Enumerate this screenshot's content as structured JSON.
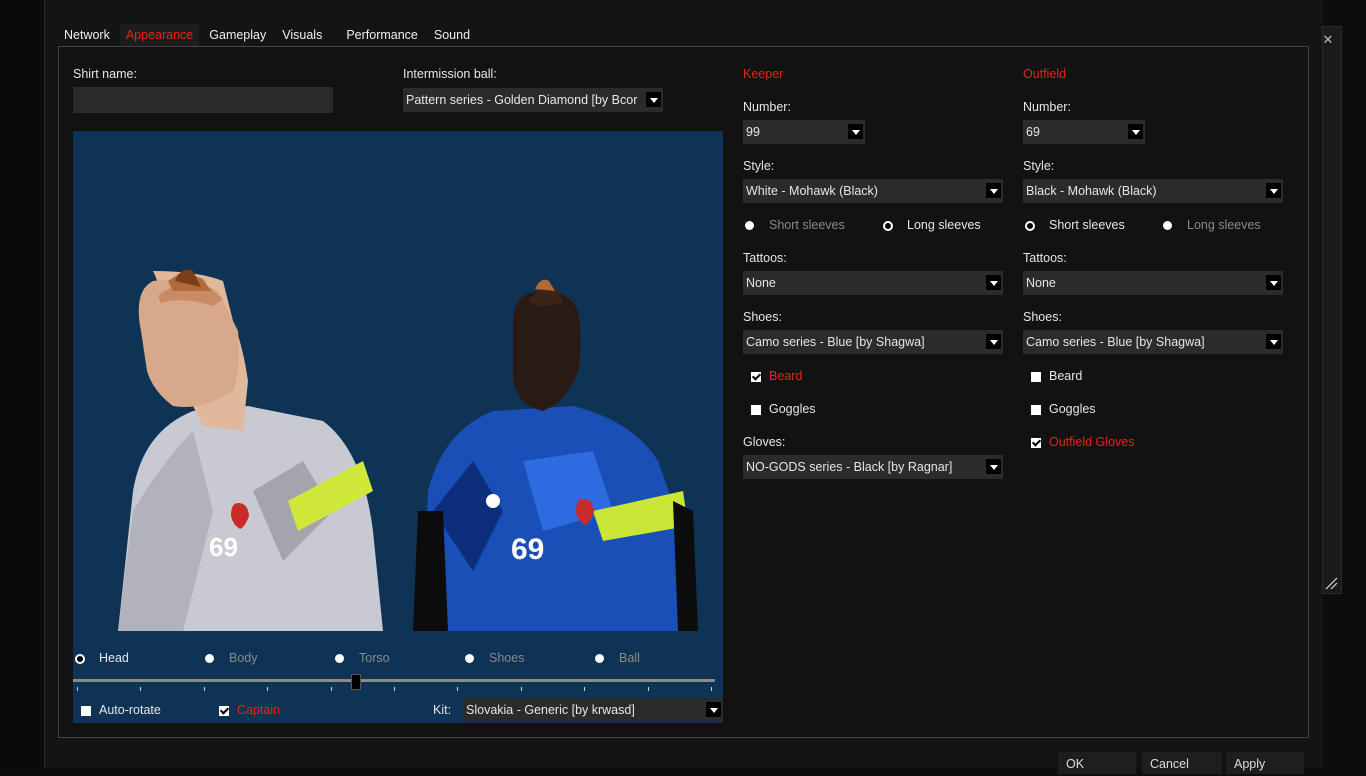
{
  "tabs": [
    "Network",
    "Appearance",
    "Gameplay",
    "Visuals",
    "Performance",
    "Sound"
  ],
  "active_tab": "Appearance",
  "shirt_name": {
    "label": "Shirt name:",
    "value": ""
  },
  "intermission_ball": {
    "label": "Intermission ball:",
    "value": "Pattern series - Golden Diamond   [by Bcor"
  },
  "preview": {
    "player1_number": "69",
    "player2_number": "69",
    "view_options": [
      {
        "label": "Head",
        "selected": true
      },
      {
        "label": "Body",
        "selected": false
      },
      {
        "label": "Torso",
        "selected": false
      },
      {
        "label": "Shoes",
        "selected": false
      },
      {
        "label": "Ball",
        "selected": false
      }
    ],
    "zoom_fraction": 0.44,
    "auto_rotate": {
      "label": "Auto-rotate",
      "checked": false
    },
    "captain": {
      "label": "Captain",
      "checked": true
    },
    "kit": {
      "label": "Kit:",
      "value": "Slovakia - Generic   [by krwasd]"
    }
  },
  "keeper": {
    "title": "Keeper",
    "number_label": "Number:",
    "number": "99",
    "style_label": "Style:",
    "style": "White - Mohawk (Black)",
    "short_sleeves": "Short sleeves",
    "long_sleeves": "Long sleeves",
    "sleeves_selected": "long",
    "tattoos_label": "Tattoos:",
    "tattoos": "None",
    "shoes_label": "Shoes:",
    "shoes": "Camo series - Blue   [by Shagwa]",
    "beard": {
      "label": "Beard",
      "checked": true
    },
    "goggles": {
      "label": "Goggles",
      "checked": false
    },
    "gloves_label": "Gloves:",
    "gloves": "NO-GODS series - Black   [by Ragnar]"
  },
  "outfield": {
    "title": "Outfield",
    "number_label": "Number:",
    "number": "69",
    "style_label": "Style:",
    "style": "Black - Mohawk (Black)",
    "short_sleeves": "Short sleeves",
    "long_sleeves": "Long sleeves",
    "sleeves_selected": "short",
    "tattoos_label": "Tattoos:",
    "tattoos": "None",
    "shoes_label": "Shoes:",
    "shoes": "Camo series - Blue   [by Shagwa]",
    "beard": {
      "label": "Beard",
      "checked": false
    },
    "goggles": {
      "label": "Goggles",
      "checked": false
    },
    "outfield_gloves": {
      "label": "Outfield Gloves",
      "checked": true
    }
  },
  "buttons": {
    "ok": "OK",
    "cancel": "Cancel",
    "apply": "Apply"
  },
  "colors": {
    "accent_red": "#e8231b",
    "preview_bg": "#0f3354",
    "panel_bg": "#121212"
  }
}
